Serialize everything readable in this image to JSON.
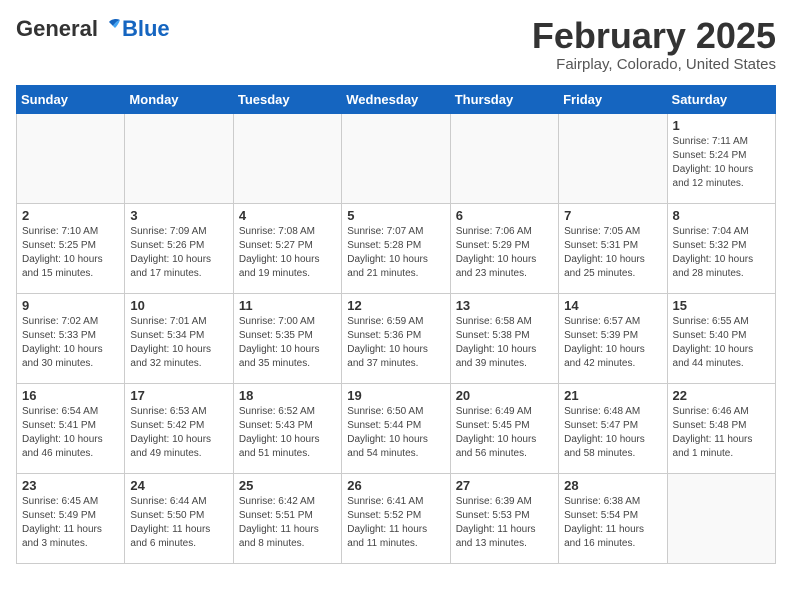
{
  "header": {
    "logo": {
      "part1": "General",
      "part2": "Blue"
    },
    "title": "February 2025",
    "location": "Fairplay, Colorado, United States"
  },
  "weekdays": [
    "Sunday",
    "Monday",
    "Tuesday",
    "Wednesday",
    "Thursday",
    "Friday",
    "Saturday"
  ],
  "weeks": [
    [
      {
        "day": "",
        "info": ""
      },
      {
        "day": "",
        "info": ""
      },
      {
        "day": "",
        "info": ""
      },
      {
        "day": "",
        "info": ""
      },
      {
        "day": "",
        "info": ""
      },
      {
        "day": "",
        "info": ""
      },
      {
        "day": "1",
        "info": "Sunrise: 7:11 AM\nSunset: 5:24 PM\nDaylight: 10 hours\nand 12 minutes."
      }
    ],
    [
      {
        "day": "2",
        "info": "Sunrise: 7:10 AM\nSunset: 5:25 PM\nDaylight: 10 hours\nand 15 minutes."
      },
      {
        "day": "3",
        "info": "Sunrise: 7:09 AM\nSunset: 5:26 PM\nDaylight: 10 hours\nand 17 minutes."
      },
      {
        "day": "4",
        "info": "Sunrise: 7:08 AM\nSunset: 5:27 PM\nDaylight: 10 hours\nand 19 minutes."
      },
      {
        "day": "5",
        "info": "Sunrise: 7:07 AM\nSunset: 5:28 PM\nDaylight: 10 hours\nand 21 minutes."
      },
      {
        "day": "6",
        "info": "Sunrise: 7:06 AM\nSunset: 5:29 PM\nDaylight: 10 hours\nand 23 minutes."
      },
      {
        "day": "7",
        "info": "Sunrise: 7:05 AM\nSunset: 5:31 PM\nDaylight: 10 hours\nand 25 minutes."
      },
      {
        "day": "8",
        "info": "Sunrise: 7:04 AM\nSunset: 5:32 PM\nDaylight: 10 hours\nand 28 minutes."
      }
    ],
    [
      {
        "day": "9",
        "info": "Sunrise: 7:02 AM\nSunset: 5:33 PM\nDaylight: 10 hours\nand 30 minutes."
      },
      {
        "day": "10",
        "info": "Sunrise: 7:01 AM\nSunset: 5:34 PM\nDaylight: 10 hours\nand 32 minutes."
      },
      {
        "day": "11",
        "info": "Sunrise: 7:00 AM\nSunset: 5:35 PM\nDaylight: 10 hours\nand 35 minutes."
      },
      {
        "day": "12",
        "info": "Sunrise: 6:59 AM\nSunset: 5:36 PM\nDaylight: 10 hours\nand 37 minutes."
      },
      {
        "day": "13",
        "info": "Sunrise: 6:58 AM\nSunset: 5:38 PM\nDaylight: 10 hours\nand 39 minutes."
      },
      {
        "day": "14",
        "info": "Sunrise: 6:57 AM\nSunset: 5:39 PM\nDaylight: 10 hours\nand 42 minutes."
      },
      {
        "day": "15",
        "info": "Sunrise: 6:55 AM\nSunset: 5:40 PM\nDaylight: 10 hours\nand 44 minutes."
      }
    ],
    [
      {
        "day": "16",
        "info": "Sunrise: 6:54 AM\nSunset: 5:41 PM\nDaylight: 10 hours\nand 46 minutes."
      },
      {
        "day": "17",
        "info": "Sunrise: 6:53 AM\nSunset: 5:42 PM\nDaylight: 10 hours\nand 49 minutes."
      },
      {
        "day": "18",
        "info": "Sunrise: 6:52 AM\nSunset: 5:43 PM\nDaylight: 10 hours\nand 51 minutes."
      },
      {
        "day": "19",
        "info": "Sunrise: 6:50 AM\nSunset: 5:44 PM\nDaylight: 10 hours\nand 54 minutes."
      },
      {
        "day": "20",
        "info": "Sunrise: 6:49 AM\nSunset: 5:45 PM\nDaylight: 10 hours\nand 56 minutes."
      },
      {
        "day": "21",
        "info": "Sunrise: 6:48 AM\nSunset: 5:47 PM\nDaylight: 10 hours\nand 58 minutes."
      },
      {
        "day": "22",
        "info": "Sunrise: 6:46 AM\nSunset: 5:48 PM\nDaylight: 11 hours\nand 1 minute."
      }
    ],
    [
      {
        "day": "23",
        "info": "Sunrise: 6:45 AM\nSunset: 5:49 PM\nDaylight: 11 hours\nand 3 minutes."
      },
      {
        "day": "24",
        "info": "Sunrise: 6:44 AM\nSunset: 5:50 PM\nDaylight: 11 hours\nand 6 minutes."
      },
      {
        "day": "25",
        "info": "Sunrise: 6:42 AM\nSunset: 5:51 PM\nDaylight: 11 hours\nand 8 minutes."
      },
      {
        "day": "26",
        "info": "Sunrise: 6:41 AM\nSunset: 5:52 PM\nDaylight: 11 hours\nand 11 minutes."
      },
      {
        "day": "27",
        "info": "Sunrise: 6:39 AM\nSunset: 5:53 PM\nDaylight: 11 hours\nand 13 minutes."
      },
      {
        "day": "28",
        "info": "Sunrise: 6:38 AM\nSunset: 5:54 PM\nDaylight: 11 hours\nand 16 minutes."
      },
      {
        "day": "",
        "info": ""
      }
    ]
  ]
}
